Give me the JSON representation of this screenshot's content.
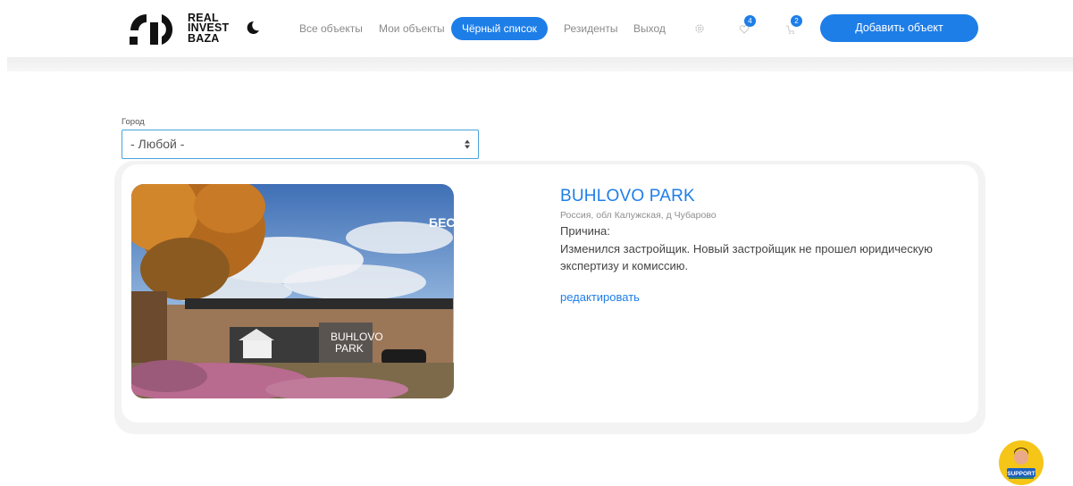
{
  "logo": {
    "line1": "REAL",
    "line2": "INVEST",
    "line3": "BAZA"
  },
  "nav": {
    "items": [
      {
        "label": "Все объекты"
      },
      {
        "label": "Мои объекты"
      },
      {
        "label": "Чёрный список"
      },
      {
        "label": "Резиденты"
      },
      {
        "label": "Выход"
      }
    ],
    "active_index": 2
  },
  "header": {
    "settings_icon": "gear-icon",
    "favorites_icon": "heart-icon",
    "favorites_count": "4",
    "cart_icon": "cart-icon",
    "cart_count": "2",
    "theme_icon": "moon-icon",
    "add_button_label": "Добавить объект"
  },
  "filter": {
    "city_label": "Город",
    "city_value": "- Любой -"
  },
  "object": {
    "title": "BUHLOVO PARK",
    "address": "Россия, обл Калужская, д Чубарово",
    "reason_label": "Причина:",
    "reason_text": "Изменился застройщик. Новый застройщик не прошел юридическую экспертизу и комиссию.",
    "edit_label": "редактировать",
    "photo_sign_line1": "BUHLOVO",
    "photo_sign_line2": "PARK",
    "photo_corner_text": "БЕС"
  },
  "support": {
    "label": "SUPPORT"
  },
  "colors": {
    "accent": "#1e7ee8",
    "text": "#444444",
    "muted": "#8f8f8f"
  }
}
